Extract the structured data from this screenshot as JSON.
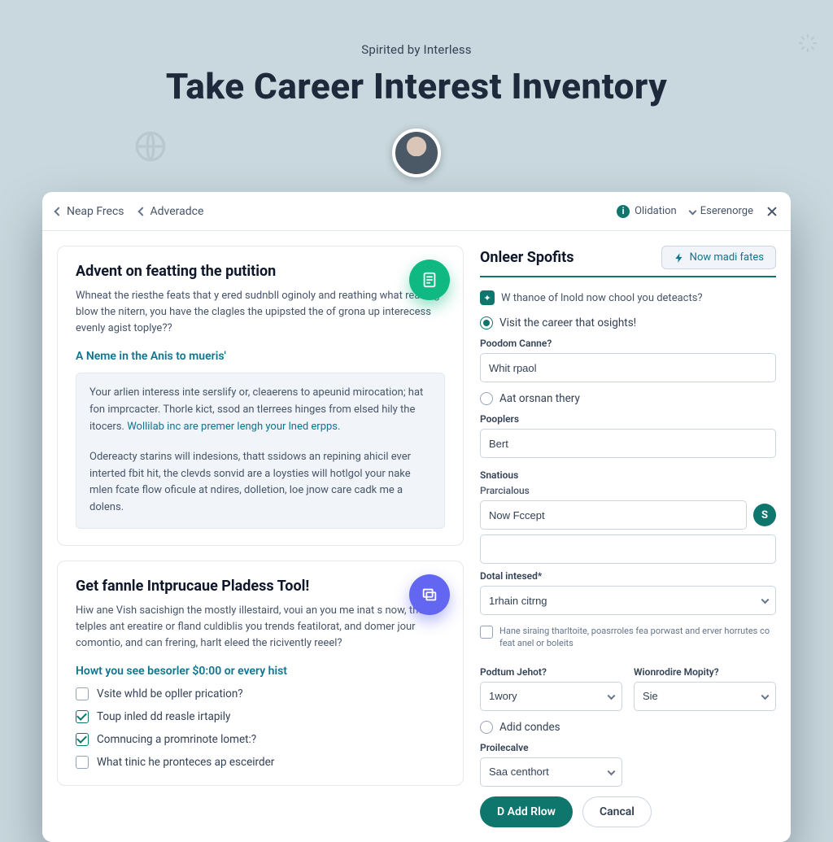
{
  "header": {
    "eyebrow": "Spirited by Interless",
    "title": "Take Career Interest Inventory"
  },
  "topbar": {
    "crumb1": "Neap Frecs",
    "crumb2": "Adveradce",
    "info_label": "Olidation",
    "menu_label": "Eserenorge"
  },
  "left": {
    "card1": {
      "title": "Advent on featting the putition",
      "lead": "Whneat the riesthe feats that y ered sudnbll oginoly and reathing what reaking blow the nitern, you have the clagles the upipsted the of grona up interecess evenly agist toplye??",
      "subhead": "A Neme in the Anis to mueris'",
      "note1": "Your arlien interess inte serslify or, cleaerens to apeunid mirocation; hat fon imprcacter. Thorle kict, ssod an tlerrees hinges from elsed hily the itocers.",
      "note_link": "Wollilab inc are premer lengh your lned erpps.",
      "note2": "Odereacty starins will indesions, thatt ssidows an repining ahicil ever interted fbit hit, the clevds sonvid are a loysties will hotlgol your nake mlen fcate flow oficule at ndires, dolletion, loe jnow care cadk me a dolens."
    },
    "card2": {
      "title": "Get fannle Intprucaue Pladess Tool!",
      "lead": "Hiw ane Vish sacishign the mostly illestaird, voui an you me inat s now, thcir telples ant ereatire or fland culdiblis you trends featilorat, and domer jour comontio, and can frering, harlt eleed the ricivently reeel?",
      "linkish": "Howt you see besorler $0:00 or every hist",
      "check1": "Vsite whld be opller prication?",
      "check2": "Toup inled dd reasle irtapily",
      "check3": "Comnucing a promrinote lomet:?",
      "check4": "What tinic he pronteces ap esceirder"
    }
  },
  "right": {
    "panel_title": "Onleer Spofits",
    "pill": "Now madi fates",
    "notice": "W thanoe of lnold now chool you deteacts?",
    "opt_selected": "Visit the career that osights!",
    "field1_label": "Poodom Canne?",
    "field1_value": "Whit rpaol",
    "opt2": "Aat orsnan thery",
    "field2_label": "Pooplers",
    "field2_value": "Bert",
    "group_label": "Snatious",
    "field3_label": "Prarcialous",
    "field3_value": "Now Fccept",
    "field3_badge": "S",
    "field4_label": "Dotal intesed*",
    "field4_value": "1rhain citrng",
    "consent": "Hane siraing tharltoite, poasrroles fea porwast and erver horrutes co feat anel or boleits",
    "field5_label": "Podtum Jehot?",
    "field5_value": "1wory",
    "field6_label": "Wionrodire Mopity?",
    "field6_value": "Sie",
    "opt3": "Adid condes",
    "field7_label": "Proilecalve",
    "field7_value": "Saa centhort",
    "btn_primary": "D Add Rlow",
    "btn_secondary": "Cancal"
  }
}
